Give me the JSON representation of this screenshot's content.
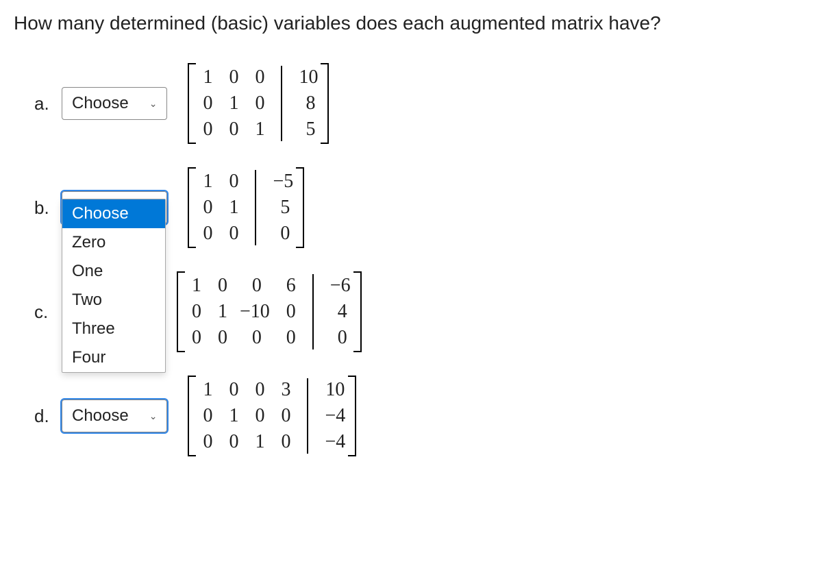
{
  "question": "How many determined (basic) variables does each augmented matrix have?",
  "select_placeholder": "Choose",
  "options": [
    "Choose",
    "Zero",
    "One",
    "Two",
    "Three",
    "Four"
  ],
  "items": [
    {
      "label": "a.",
      "matrix": {
        "cols": [
          [
            "1",
            "0",
            "0"
          ],
          [
            "0",
            "1",
            "0"
          ],
          [
            "0",
            "0",
            "1"
          ]
        ],
        "aug": [
          "10",
          "8",
          "5"
        ]
      }
    },
    {
      "label": "b.",
      "matrix": {
        "cols": [
          [
            "1",
            "0",
            "0"
          ],
          [
            "0",
            "1",
            "0"
          ]
        ],
        "aug": [
          "−5",
          "5",
          "0"
        ]
      },
      "dropdown_open": true
    },
    {
      "label": "c.",
      "matrix": {
        "cols": [
          [
            "1",
            "0",
            "0"
          ],
          [
            "0",
            "1",
            "0"
          ],
          [
            "0",
            "−10",
            "0"
          ],
          [
            "6",
            "0",
            "0"
          ]
        ],
        "aug": [
          "−6",
          "4",
          "0"
        ]
      }
    },
    {
      "label": "d.",
      "matrix": {
        "cols": [
          [
            "1",
            "0",
            "0"
          ],
          [
            "0",
            "1",
            "0"
          ],
          [
            "0",
            "0",
            "1"
          ],
          [
            "3",
            "0",
            "0"
          ]
        ],
        "aug": [
          "10",
          "−4",
          "−4"
        ]
      }
    }
  ]
}
